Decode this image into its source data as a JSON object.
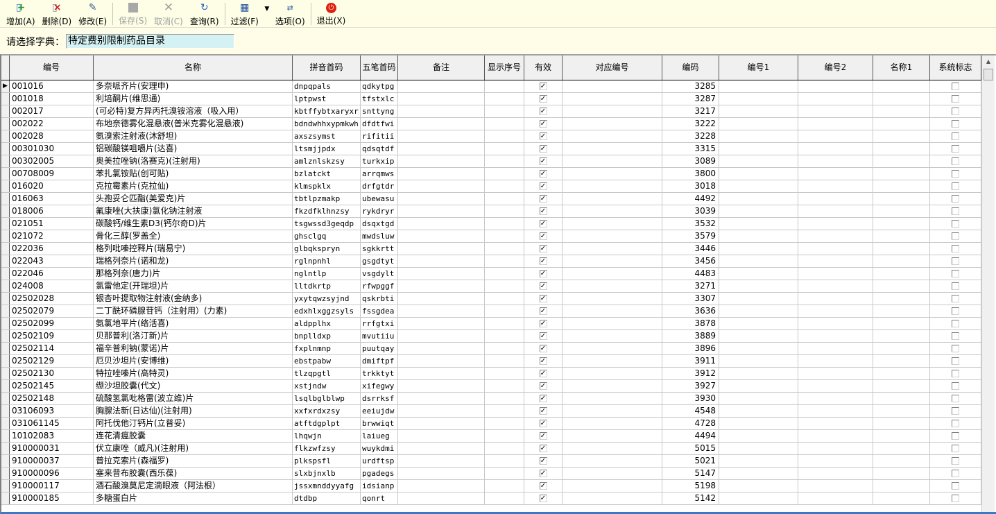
{
  "toolbar": {
    "buttons": [
      {
        "name": "add",
        "label": "增加(A)",
        "icon": "add-doc-icon",
        "enabled": true
      },
      {
        "name": "delete",
        "label": "删除(D)",
        "icon": "delete-doc-icon",
        "enabled": true
      },
      {
        "name": "edit",
        "label": "修改(E)",
        "icon": "edit-doc-icon",
        "enabled": true
      },
      {
        "name": "save",
        "label": "保存(S)",
        "icon": "save-icon",
        "enabled": false
      },
      {
        "name": "cancel",
        "label": "取消(C)",
        "icon": "cancel-x-icon",
        "enabled": false
      },
      {
        "name": "query",
        "label": "查询(R)",
        "icon": "refresh-icon",
        "enabled": true
      },
      {
        "name": "filter",
        "label": "过滤(F)",
        "icon": "filter-icon",
        "enabled": true
      },
      {
        "name": "options",
        "label": "选项(O)",
        "icon": "options-icon",
        "enabled": true
      },
      {
        "name": "exit",
        "label": "退出(X)",
        "icon": "power-icon",
        "enabled": true
      }
    ]
  },
  "filter": {
    "label": "请选择字典：",
    "value": "特定费别限制药品目录"
  },
  "grid": {
    "columns": [
      "编号",
      "名称",
      "拼音首码",
      "五笔首码",
      "备注",
      "显示序号",
      "有效",
      "对应编号",
      "编码",
      "编号1",
      "编号2",
      "名称1",
      "系统标志"
    ],
    "rows": [
      [
        "001016",
        "多奈哌齐片(安理申)",
        "dnpqpals",
        "qdkytpg",
        "3285"
      ],
      [
        "001018",
        "利培酮片(维思通)",
        "lptpwst",
        "tfstxlc",
        "3287"
      ],
      [
        "002017",
        "(可必特)复方异丙托溴铵溶液（吸入用）",
        "kbtffybtxaryxr",
        "snttyng",
        "3217"
      ],
      [
        "002022",
        "布地奈德雾化混悬液(普米克雾化混悬液)",
        "bdndwhhxypmkwh",
        "dfdtfwi",
        "3222"
      ],
      [
        "002028",
        "氨溴索注射液(沐舒坦)",
        "axszsymst",
        "rifitii",
        "3228"
      ],
      [
        "00301030",
        "铝碳酸镁咀嚼片(达喜)",
        "ltsmjjpdx",
        "qdsqtdf",
        "3315"
      ],
      [
        "00302005",
        "奥美拉唑钠(洛赛克)(注射用)",
        "amlznlskzsy",
        "turkxip",
        "3089"
      ],
      [
        "00708009",
        "苯扎氯铵贴(创可贴)",
        "bzlatckt",
        "arrqmws",
        "3800"
      ],
      [
        "016020",
        "克拉霉素片(克拉仙)",
        "klmspklx",
        "drfgtdr",
        "3018"
      ],
      [
        "016063",
        "头孢妥仑匹酯(美爱克)片",
        "tbtlpzmakp",
        "ubewasu",
        "4492"
      ],
      [
        "018006",
        "氟康唑(大扶康)氯化钠注射液",
        "fkzdfklhnzsy",
        "rykdryr",
        "3039"
      ],
      [
        "021051",
        "碳酸钙/维生素D3(钙尔奇D)片",
        "tsgwssd3geqdp",
        "dsqxtgd",
        "3532"
      ],
      [
        "021072",
        "骨化三醇(罗盖全)",
        "ghsclgq",
        "mwdsluw",
        "3579"
      ],
      [
        "022036",
        "格列吡嗪控释片(瑞易宁)",
        "glbqkspryn",
        "sgkkrtt",
        "3446"
      ],
      [
        "022043",
        "瑞格列奈片(诺和龙)",
        "rglnpnhl",
        "gsgdtyt",
        "3456"
      ],
      [
        "022046",
        "那格列奈(唐力)片",
        "nglntlp",
        "vsgdylt",
        "4483"
      ],
      [
        "024008",
        "氯雷他定(开瑞坦)片",
        "lltdkrtp",
        "rfwpggf",
        "3271"
      ],
      [
        "02502028",
        "银杏叶提取物注射液(金纳多)",
        "yxytqwzsyjnd",
        "qskrbti",
        "3307"
      ],
      [
        "02502079",
        "二丁酰环磷腺苷钙（注射用）(力素)",
        "edxhlxggzsyls",
        "fssgdea",
        "3636"
      ],
      [
        "02502099",
        "氨氯地平片(络活喜)",
        "aldpplhx",
        "rrfgtxi",
        "3878"
      ],
      [
        "02502109",
        "贝那普利(洛汀新)片",
        "bnplldxp",
        "mvutiiu",
        "3889"
      ],
      [
        "02502114",
        "福辛普利钠(蒙诺)片",
        "fxplnmnp",
        "puutqay",
        "3896"
      ],
      [
        "02502129",
        "厄贝沙坦片(安博维)",
        "ebstpabw",
        "dmiftpf",
        "3911"
      ],
      [
        "02502130",
        "特拉唑嗪片(高特灵)",
        "tlzqpgtl",
        "trkktyt",
        "3912"
      ],
      [
        "02502145",
        "缬沙坦胶囊(代文)",
        "xstjndw",
        "xifegwy",
        "3927"
      ],
      [
        "02502148",
        "硫酸氢氯吡格雷(波立维)片",
        "lsqlbglblwp",
        "dsrrksf",
        "3930"
      ],
      [
        "03106093",
        "胸腺法新(日达仙)(注射用)",
        "xxfxrdxzsy",
        "eeiujdw",
        "4548"
      ],
      [
        "031061145",
        "阿托伐他汀钙片(立普妥)",
        "atftdgplpt",
        "brwwiqt",
        "4728"
      ],
      [
        "10102083",
        "连花清瘟胶囊",
        "lhqwjn",
        "laiueg",
        "4494"
      ],
      [
        "910000031",
        "伏立康唑（威凡)(注射用)",
        "flkzwfzsy",
        "wuykdmi",
        "5015"
      ],
      [
        "910000037",
        "普拉克索片(森福罗)",
        "plkspsfl",
        "urdftsp",
        "5021"
      ],
      [
        "910000096",
        "塞来昔布胶囊(西乐葆)",
        "slxbjnxlb",
        "pgadegs",
        "5147"
      ],
      [
        "910000117",
        "酒石酸溴莫尼定滴眼液（阿法根）",
        "jssxmnddyyafg",
        "idsianp",
        "5198"
      ],
      [
        "910000185",
        "多糖蛋白片",
        "dtdbp",
        "qonrt",
        "5142"
      ]
    ],
    "valid_checked": true,
    "system_flag_checked": false,
    "current_row": 0
  }
}
